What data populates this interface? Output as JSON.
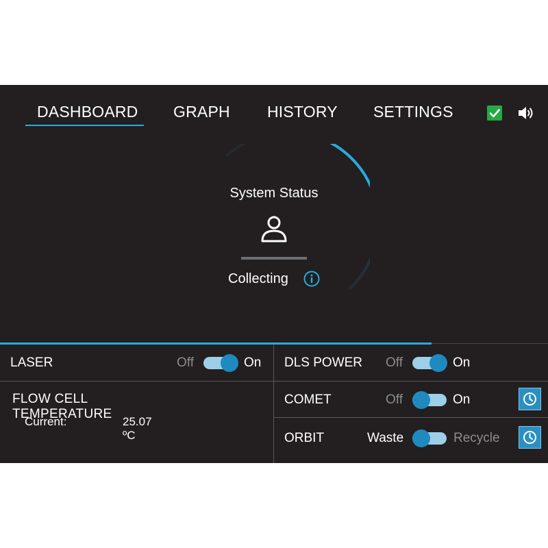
{
  "nav": {
    "tabs": [
      {
        "label": "DASHBOARD",
        "active": true
      },
      {
        "label": "GRAPH",
        "active": false
      },
      {
        "label": "HISTORY",
        "active": false
      },
      {
        "label": "SETTINGS",
        "active": false
      }
    ],
    "icons": {
      "status": "check-icon",
      "sound": "speaker-icon"
    },
    "accent": "#29abe2",
    "check_color": "#27a844"
  },
  "status": {
    "title": "System Status",
    "state": "Collecting",
    "icon": "person-icon",
    "info_icon": "info-icon"
  },
  "controls": {
    "laser": {
      "label": "LASER",
      "off_label": "Off",
      "on_label": "On",
      "state": "on"
    },
    "dls_power": {
      "label": "DLS POWER",
      "off_label": "Off",
      "on_label": "On",
      "state": "on"
    },
    "comet": {
      "label": "COMET",
      "off_label": "Off",
      "on_label": "On",
      "state": "off",
      "schedule_icon": "clock-icon"
    },
    "orbit": {
      "label": "ORBIT",
      "off_label": "Waste",
      "on_label": "Recycle",
      "state": "off",
      "schedule_icon": "clock-icon"
    }
  },
  "temperature": {
    "title": "FLOW CELL TEMPERATURE",
    "current_label": "Current:",
    "current_value": "25.07 ºC"
  },
  "colors": {
    "background": "#231f20",
    "toggle_track": "#9ecfe8",
    "toggle_knob": "#1f8ac0",
    "button": "#2b8fc2"
  }
}
